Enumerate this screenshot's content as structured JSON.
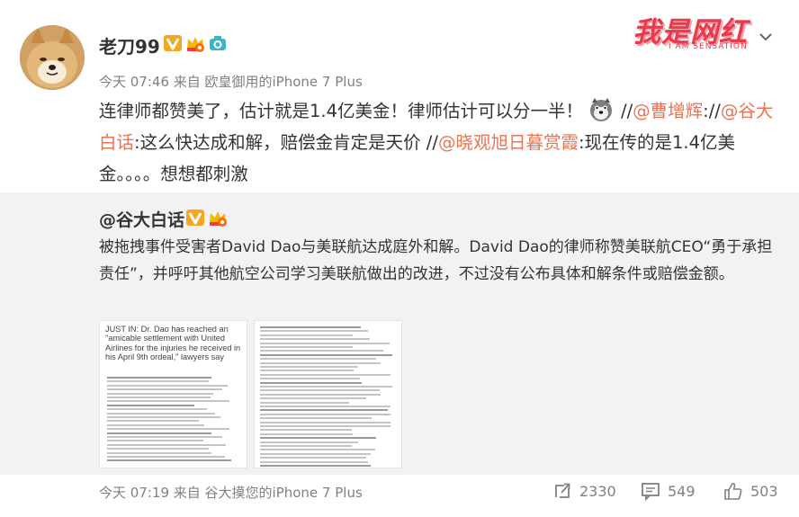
{
  "post": {
    "username": "老刀99",
    "meta": "今天 07:46 来自 欧皇御用的iPhone 7 Plus",
    "content": {
      "part1": "连律师都赞美了，估计就是1.4亿美金！律师估计可以分一半！",
      "sep1": "//",
      "mention1": "@曹增辉",
      "sep2": "://",
      "mention2": "@谷大白话",
      "part2": ":这么快达成和解，赔偿金肯定是天价 //",
      "mention3": "@晓观旭日暮赏霞",
      "part3": ":现在传的是1.4亿美金。。。。想想都刺激"
    }
  },
  "logo": {
    "main": "我是网红",
    "sub": "I AM SENSATION"
  },
  "repost": {
    "username": "@谷大白话",
    "text": "被拖拽事件受害者David Dao与美联航达成庭外和解。David Dao的律师称赞美联航CEO“勇于承担责任”，并呼吁其他航空公司学习美联航做出的改进，不过没有公布具体和解条件或赔偿金额。",
    "thumb1_headline": "JUST IN: Dr. Dao has reached an \"amicable settlement with United Airlines for the injuries he received in his April 9th ordeal,\" lawyers say",
    "footer_meta": "今天 07:19 来自 谷大摸您的iPhone 7 Plus"
  },
  "actions": {
    "repost_count": "2330",
    "comment_count": "549",
    "like_count": "503"
  },
  "colors": {
    "mention": "#eb7350",
    "repost_bg": "#f2f2f5",
    "logo": "#e8394d",
    "meta": "#808080"
  },
  "icons": [
    "v-verified-icon",
    "crown-badge-icon",
    "camera-badge-icon",
    "chevron-down-icon",
    "dog-emoji-icon",
    "repost-icon",
    "comment-icon",
    "like-icon"
  ]
}
